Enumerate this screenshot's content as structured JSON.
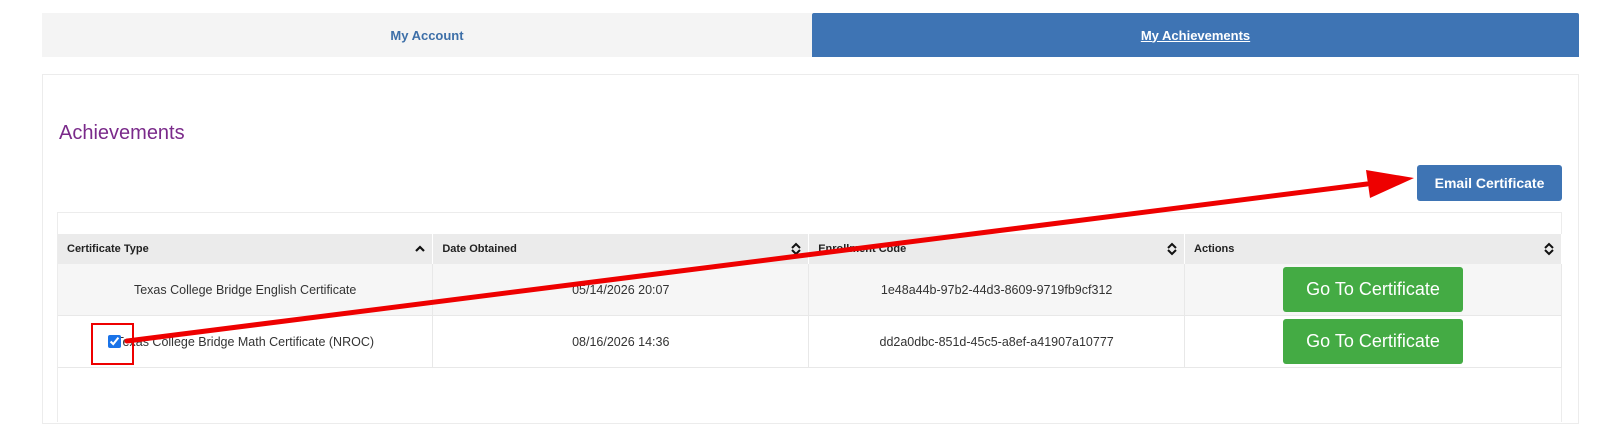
{
  "tabs": {
    "account": "My Account",
    "achievements": "My Achievements"
  },
  "page": {
    "heading": "Achievements",
    "email_button": "Email Certificate"
  },
  "table": {
    "columns": [
      "Certificate Type",
      "Date Obtained",
      "Enrollment Code",
      "Actions"
    ],
    "sort_icons": [
      "sort-ascending-icon",
      "sort-both-icon",
      "sort-both-icon",
      "sort-both-icon"
    ],
    "rows": [
      {
        "certificate": "Texas College Bridge English Certificate",
        "date": "05/14/2026 20:07",
        "code": "1e48a44b-97b2-44d3-8609-9719fb9cf312",
        "action": "Go To Certificate",
        "checked": false
      },
      {
        "certificate": "Texas College Bridge Math Certificate (NROC)",
        "date": "08/16/2026 14:36",
        "code": "dd2a0dbc-851d-45c5-a8ef-a41907a10777",
        "action": "Go To Certificate",
        "checked": true
      }
    ]
  },
  "colors": {
    "accent_blue": "#3e74b4",
    "heading_purple": "#7a2a8a",
    "action_green": "#44ab44",
    "annotation_red": "#ee0000"
  }
}
